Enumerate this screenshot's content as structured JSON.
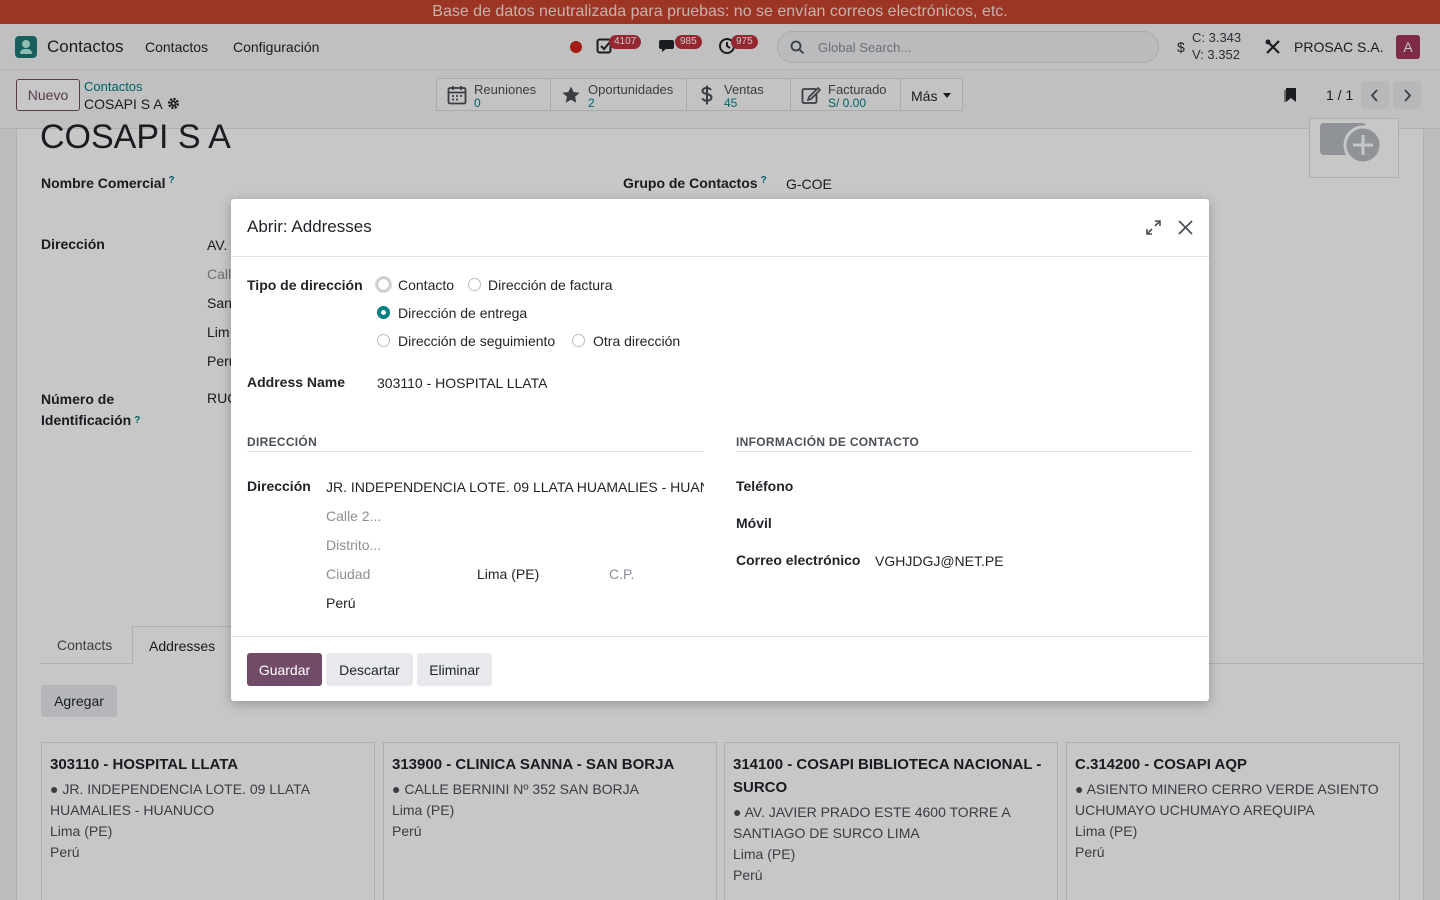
{
  "banner": {
    "text": "Base de datos neutralizada para pruebas: no se envían correos electrónicos, etc."
  },
  "navbar": {
    "app_name": "Contactos",
    "menus": [
      "Contactos",
      "Configuración"
    ],
    "activities_count": "4107",
    "messages_count": "985",
    "clock_count": "975",
    "search_placeholder": "Global Search...",
    "currency_symbol": "$",
    "rate_buy": "C: 3.343",
    "rate_sell": "V: 3.352",
    "company": "PROSAC S.A.",
    "user_initial": "A",
    "colors": {
      "brand": "#714b67",
      "banner": "#c9442f",
      "badge": "#c0323e",
      "accent": "#017e84"
    }
  },
  "control": {
    "new_button": "Nuevo",
    "breadcrumb_parent": "Contactos",
    "breadcrumb_current": "COSAPI S A",
    "smart_buttons": [
      {
        "label": "Reuniones",
        "value": "0",
        "icon": "calendar-icon"
      },
      {
        "label": "Oportunidades",
        "value": "2",
        "icon": "star-icon"
      },
      {
        "label": "Ventas",
        "value": "45",
        "icon": "dollar-icon"
      },
      {
        "label": "Facturado",
        "value": "S/ 0.00",
        "icon": "invoice-edit-icon"
      }
    ],
    "more_button": "Más",
    "pager": "1 / 1"
  },
  "form": {
    "record_name": "COSAPI S A",
    "trade_name_label": "Nombre Comercial",
    "group_label": "Grupo de Contactos",
    "group_value": "G-COE",
    "address_label": "Dirección",
    "address_lines": [
      "AV.",
      "Call",
      "San",
      "Lim",
      "Perú"
    ],
    "id_label_1": "Número de",
    "id_label_2": "Identificación",
    "id_value": "RUC",
    "qmark": "?",
    "tabs": [
      "Contacts",
      "Addresses"
    ],
    "add_button": "Agregar",
    "address_cards": [
      {
        "title": "303110 - HOSPITAL LLATA",
        "street": "JR. INDEPENDENCIA LOTE. 09 LLATA HUAMALIES - HUANUCO",
        "city": "Lima (PE)",
        "country": "Perú"
      },
      {
        "title": "313900 - CLINICA SANNA - SAN BORJA",
        "street": "CALLE BERNINI Nº 352 SAN BORJA",
        "city": "Lima (PE)",
        "country": "Perú"
      },
      {
        "title": "314100 - COSAPI BIBLIOTECA NACIONAL - SURCO",
        "street": "AV. JAVIER PRADO ESTE 4600 TORRE A SANTIAGO DE SURCO LIMA",
        "city": "Lima (PE)",
        "country": "Perú"
      },
      {
        "title": "C.314200 - COSAPI AQP",
        "street": "ASIENTO MINERO CERRO VERDE ASIENTO UCHUMAYO UCHUMAYO AREQUIPA",
        "city": "Lima (PE)",
        "country": "Perú"
      }
    ]
  },
  "dialog": {
    "title": "Abrir: Addresses",
    "type_label": "Tipo de dirección",
    "type_options": [
      {
        "label": "Contacto",
        "checked": false
      },
      {
        "label": "Dirección de factura",
        "checked": false
      },
      {
        "label": "Dirección de entrega",
        "checked": true
      },
      {
        "label": "Dirección de seguimiento",
        "checked": false
      },
      {
        "label": "Otra dirección",
        "checked": false
      }
    ],
    "address_name_label": "Address Name",
    "address_name_value": "303110 - HOSPITAL LLATA",
    "section_address": "DIRECCIÓN",
    "section_contact": "INFORMACIÓN DE CONTACTO",
    "direccion_label": "Dirección",
    "street_value": "JR. INDEPENDENCIA LOTE. 09 LLATA HUAMALIES - HUAN",
    "street2_placeholder": "Calle 2...",
    "district_placeholder": "Distrito...",
    "city_placeholder": "Ciudad",
    "state_value": "Lima (PE)",
    "zip_placeholder": "C.P.",
    "country_value": "Perú",
    "phone_label": "Teléfono",
    "mobile_label": "Móvil",
    "email_label": "Correo electrónico",
    "email_value": "VGHJDGJ@NET.PE",
    "save_button": "Guardar",
    "discard_button": "Descartar",
    "delete_button": "Eliminar"
  }
}
